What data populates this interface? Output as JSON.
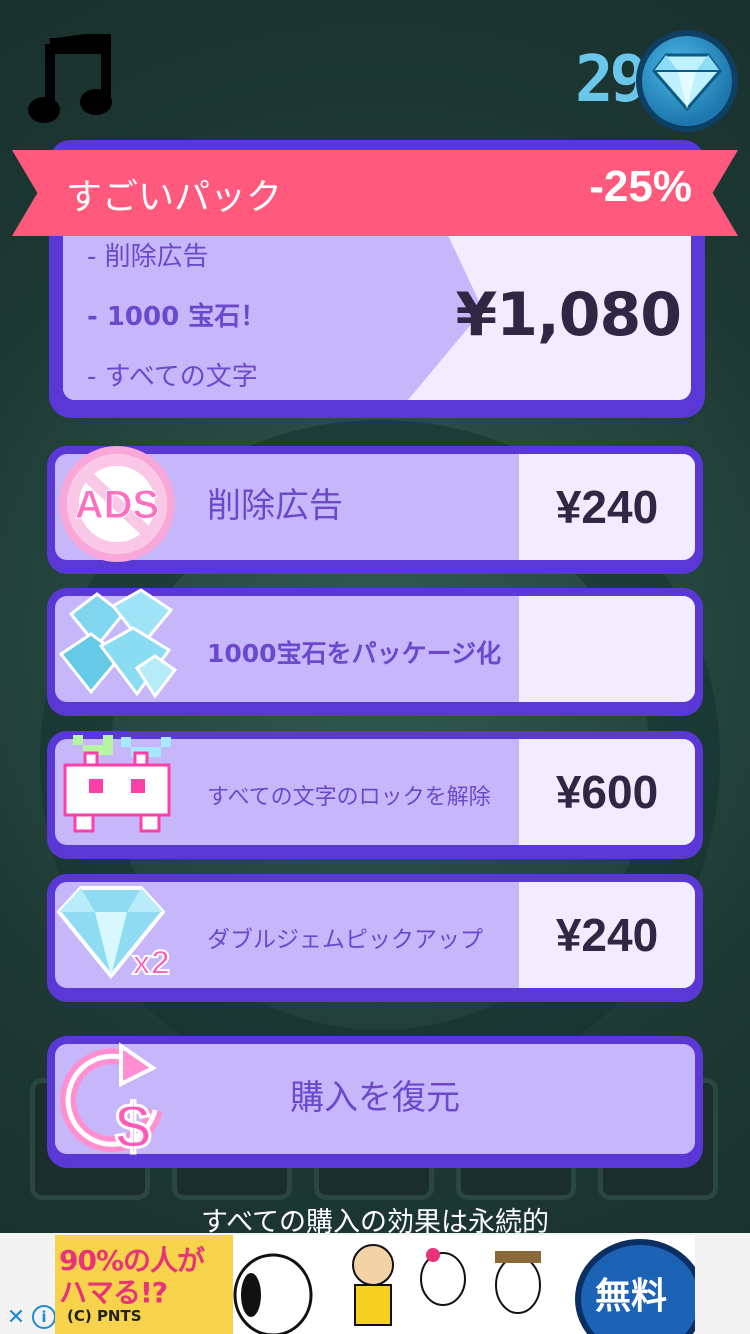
{
  "header": {
    "music_icon": "music-note-icon",
    "gem_count": "29",
    "gem_icon": "diamond-icon"
  },
  "super_pack": {
    "title": "すごいパック",
    "discount": "-25%",
    "items": [
      "- 削除広告",
      "- 1000 宝石！",
      "- すべての文字"
    ],
    "price": "¥1,080"
  },
  "shop_items": [
    {
      "label": "削除広告",
      "price": "¥240",
      "icon": "no-ads-icon"
    },
    {
      "label": "1000宝石をパッケージ化",
      "price": "",
      "icon": "diamond-pile-icon"
    },
    {
      "label": "すべての文字のロックを解除",
      "price": "¥600",
      "icon": "pixel-characters-icon"
    },
    {
      "label": "ダブルジェムピックアップ",
      "price": "¥240",
      "icon": "double-gem-icon"
    }
  ],
  "restore": {
    "label": "購入を復元",
    "icon": "restore-dollar-icon"
  },
  "footer_note": "すべての購入の効果は永続的",
  "ad": {
    "line1": "90%の人が",
    "line2": "ハマる!?",
    "copyright": "(C) PNTS",
    "free_label": "無料",
    "close_symbol": "✕",
    "info_symbol": "i"
  },
  "colors": {
    "panel_border": "#5a38d6",
    "panel_fill": "#c6b7fb",
    "price_fill": "#f1ecff",
    "ribbon": "#ff5a7d",
    "label_text": "#6b49cc"
  }
}
